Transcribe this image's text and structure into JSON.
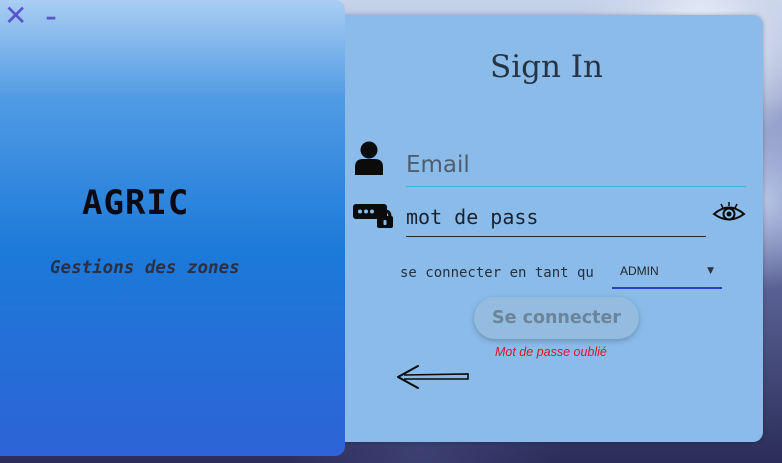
{
  "window": {
    "close_glyph": "✕",
    "minimize_glyph": "–"
  },
  "brand": {
    "name": "AGRIC",
    "tagline": "Gestions des zones"
  },
  "signin": {
    "title": "Sign In",
    "email_placeholder": "Email",
    "password_placeholder": "mot de pass",
    "role_label": "se connecter en tant qu",
    "role_selected": "ADMIN",
    "submit_label": "Se connecter",
    "forgot_label": "Mot de passe oublié"
  },
  "icons": {
    "user": "user-icon",
    "password": "password-lock-icon",
    "eye": "eye-icon",
    "back": "back-arrow-icon",
    "dropdown": "caret-down-icon"
  },
  "colors": {
    "panel_gradient_top": "#a9cdf3",
    "panel_gradient_bottom": "#2d63d6",
    "card": "#8bbce9",
    "accent_select": "#2b3ec7",
    "forgot": "#d6162a"
  }
}
